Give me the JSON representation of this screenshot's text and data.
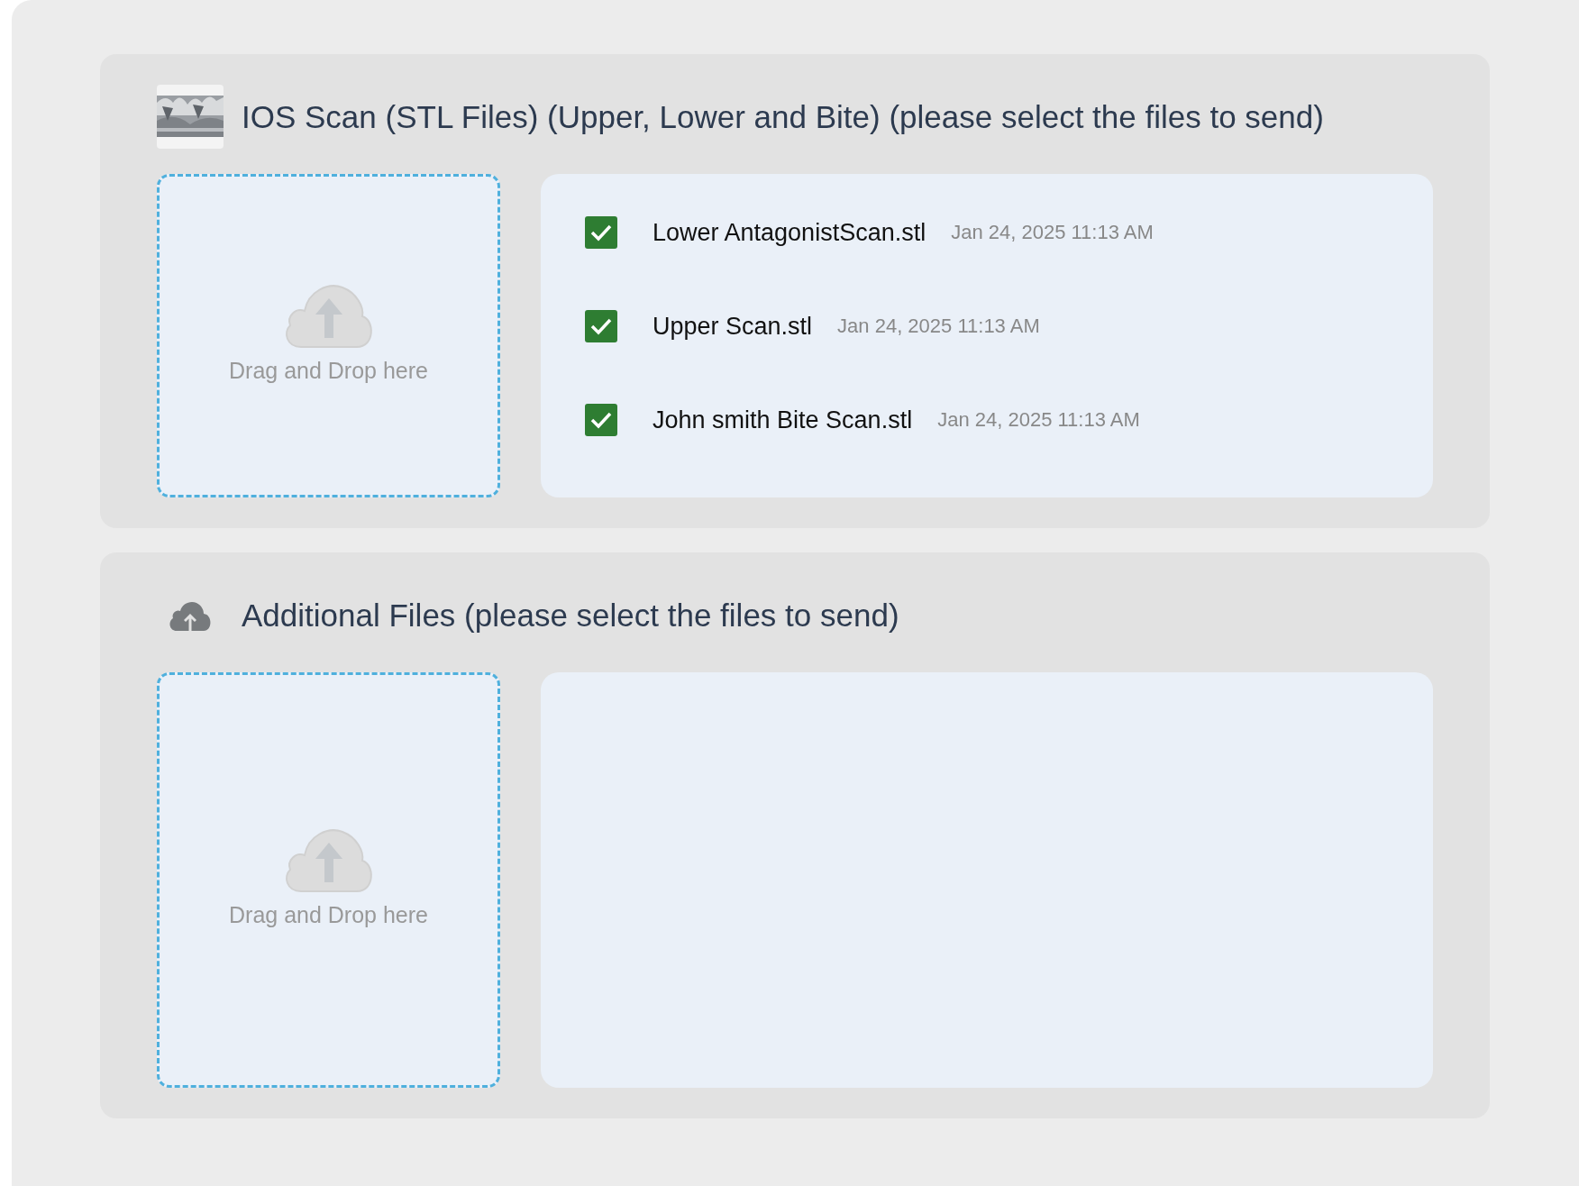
{
  "sections": [
    {
      "kind": "thumbnail",
      "title": "IOS Scan (STL Files) (Upper, Lower and Bite) (please select the files to send)",
      "dropzone": {
        "label": "Drag and Drop here"
      },
      "files": [
        {
          "name": "Lower AntagonistScan.stl",
          "date": "Jan 24, 2025 11:13 AM",
          "checked": true
        },
        {
          "name": "Upper Scan.stl",
          "date": "Jan 24, 2025 11:13 AM",
          "checked": true
        },
        {
          "name": "John smith Bite Scan.stl",
          "date": "Jan 24, 2025 11:13 AM",
          "checked": true
        }
      ]
    },
    {
      "kind": "cloud",
      "title": "Additional Files (please select the files to send)",
      "dropzone": {
        "label": "Drag and Drop here"
      }
    }
  ]
}
